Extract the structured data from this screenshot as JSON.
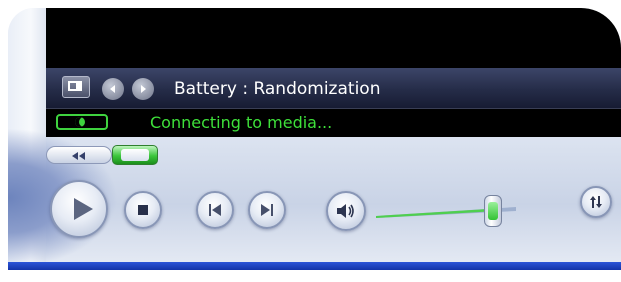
{
  "info": {
    "title": "Battery : Randomization"
  },
  "status": {
    "text": "Connecting to media..."
  },
  "icons": {
    "now_playing_toggle": "mini-view-icon",
    "previous_view": "left-arrow-icon",
    "next_view": "right-arrow-icon",
    "connection_state": "connection-status-icon",
    "rewind": "rewind-icon",
    "seek": "seek-slider-thumb",
    "play": "play-icon",
    "stop": "stop-icon",
    "previous": "previous-track-icon",
    "next": "next-track-icon",
    "mute": "speaker-icon",
    "volume": "volume-slider-thumb",
    "switch_mode": "switch-mode-icon"
  },
  "colors": {
    "status_text": "#3ee03a",
    "info_bar": "#252c48",
    "accent_blue": "#1333a8"
  },
  "volume": {
    "level_percent": 80
  }
}
